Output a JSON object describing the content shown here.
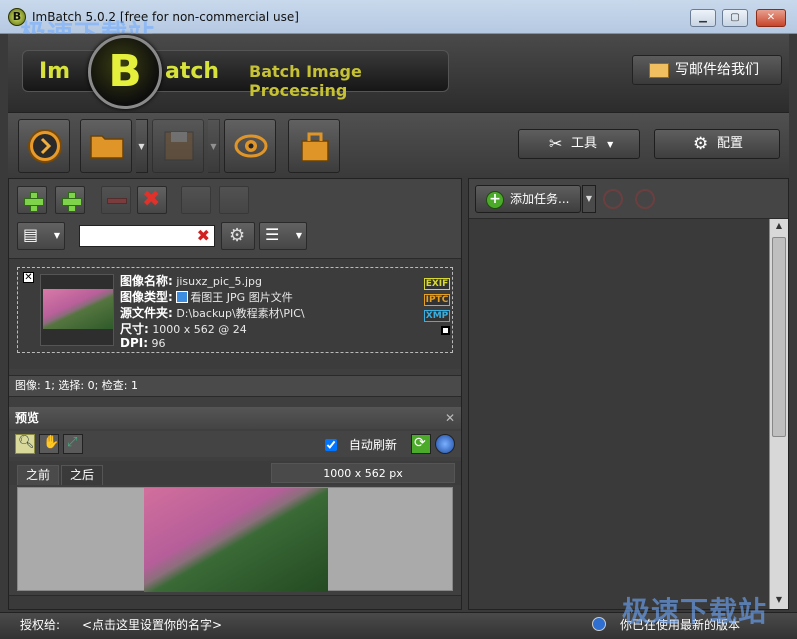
{
  "window": {
    "title": "ImBatch 5.0.2 [free for non-commercial use]",
    "watermark_top": "极速下载站",
    "watermark_bottom": "极速下载站"
  },
  "header": {
    "logo_left": "Im",
    "logo_center": "B",
    "logo_right": "atch",
    "logo_subtitle": "Batch Image Processing",
    "email_label": "写邮件给我们"
  },
  "toolbar": {
    "tools_label": "工具",
    "config_label": "配置"
  },
  "search": {
    "value": ""
  },
  "file_item": {
    "name_label": "图像名称:",
    "name_value": "jisuxz_pic_5.jpg",
    "type_label": "图像类型:",
    "type_value": "看图王 JPG 图片文件",
    "folder_label": "源文件夹:",
    "folder_value": "D:\\backup\\教程素材\\PIC\\",
    "size_label": "尺寸:",
    "size_value": "1000 x 562 @ 24",
    "dpi_label": "DPI:",
    "dpi_value": "96",
    "tags": [
      "EXIF",
      "IPTC",
      "XMP"
    ]
  },
  "status": "图像: 1; 选择: 0; 检查: 1",
  "preview": {
    "title": "预览",
    "auto_refresh_label": "自动刷新",
    "auto_refresh_checked": true,
    "tab_before": "之前",
    "tab_after": "之后",
    "dimensions": "1000 x 562 px"
  },
  "tasks": {
    "add_task_label": "添加任务..."
  },
  "statusbar": {
    "license_label": "授权给:",
    "license_value": "<点击这里设置你的名字>",
    "version_text": "你已在使用最新的版本"
  },
  "colors": {
    "accent": "#d7e23a",
    "background": "#3a3a3a",
    "add_green": "#4caa2a"
  }
}
